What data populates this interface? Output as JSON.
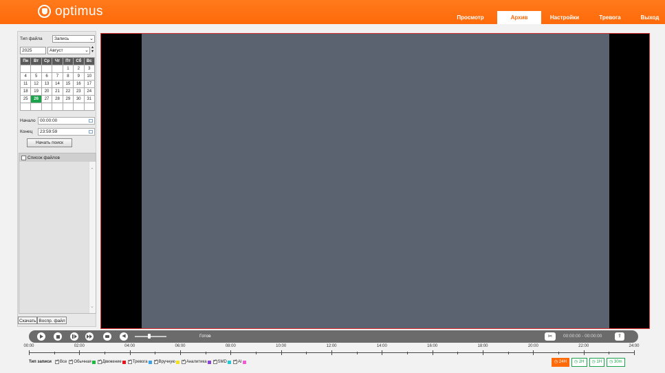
{
  "header": {
    "logo_text": "optimus",
    "nav": [
      {
        "label": "Просмотр",
        "active": false
      },
      {
        "label": "Архив",
        "active": true
      },
      {
        "label": "Настройки",
        "active": false
      },
      {
        "label": "Тревога",
        "active": false
      },
      {
        "label": "Выход",
        "active": false
      }
    ]
  },
  "search": {
    "file_type_label": "Тип файла",
    "file_type_value": "Запись",
    "year": "2025",
    "month": "Август",
    "weekdays": [
      "Пн",
      "Вт",
      "Ср",
      "Чт",
      "Пт",
      "Сб",
      "Вс"
    ],
    "weeks": [
      [
        "",
        "",
        "",
        "",
        "1",
        "2",
        "3"
      ],
      [
        "4",
        "5",
        "6",
        "7",
        "8",
        "9",
        "10"
      ],
      [
        "11",
        "12",
        "13",
        "14",
        "15",
        "16",
        "17"
      ],
      [
        "18",
        "19",
        "20",
        "21",
        "22",
        "23",
        "24"
      ],
      [
        "25",
        "26",
        "27",
        "28",
        "29",
        "30",
        "31"
      ],
      [
        "",
        "",
        "",
        "",
        "",
        "",
        ""
      ]
    ],
    "selected_day": "26",
    "start_label": "Начало",
    "start_value": "00:00:00",
    "end_label": "Конец",
    "end_value": "23:59:59",
    "search_button": "Начать поиск"
  },
  "file_list": {
    "header": "Список файлов",
    "download_button": "Скачать",
    "play_file_button": "Воспр. файл"
  },
  "player": {
    "status": "Готов",
    "clip_time": "00:00:00 - 00:00:00",
    "volume_icon": "speaker-icon",
    "volume": 0.5
  },
  "timeline": {
    "labels": [
      "00:00",
      "02:00",
      "04:00",
      "06:00",
      "08:00",
      "10:00",
      "12:00",
      "14:00",
      "16:00",
      "18:00",
      "20:00",
      "22:00",
      "24:00"
    ]
  },
  "legend": {
    "title": "Тип записи",
    "items": [
      {
        "label": "Все",
        "color": null
      },
      {
        "label": "Обычная",
        "color": "#1db83e"
      },
      {
        "label": "Движение",
        "color": "#e8131a"
      },
      {
        "label": "Тревога",
        "color": "#3aa1e6"
      },
      {
        "label": "Вручную",
        "color": "#f3e21a"
      },
      {
        "label": "Аналитика",
        "color": "#8b44d8"
      },
      {
        "label": "SMD",
        "color": "#22c9d6"
      },
      {
        "label": "AI",
        "color": "#f15ad7"
      }
    ]
  },
  "zoom": [
    {
      "label": "24H",
      "active": true
    },
    {
      "label": "2H",
      "active": false
    },
    {
      "label": "1H",
      "active": false
    },
    {
      "label": "30m",
      "active": false
    }
  ]
}
